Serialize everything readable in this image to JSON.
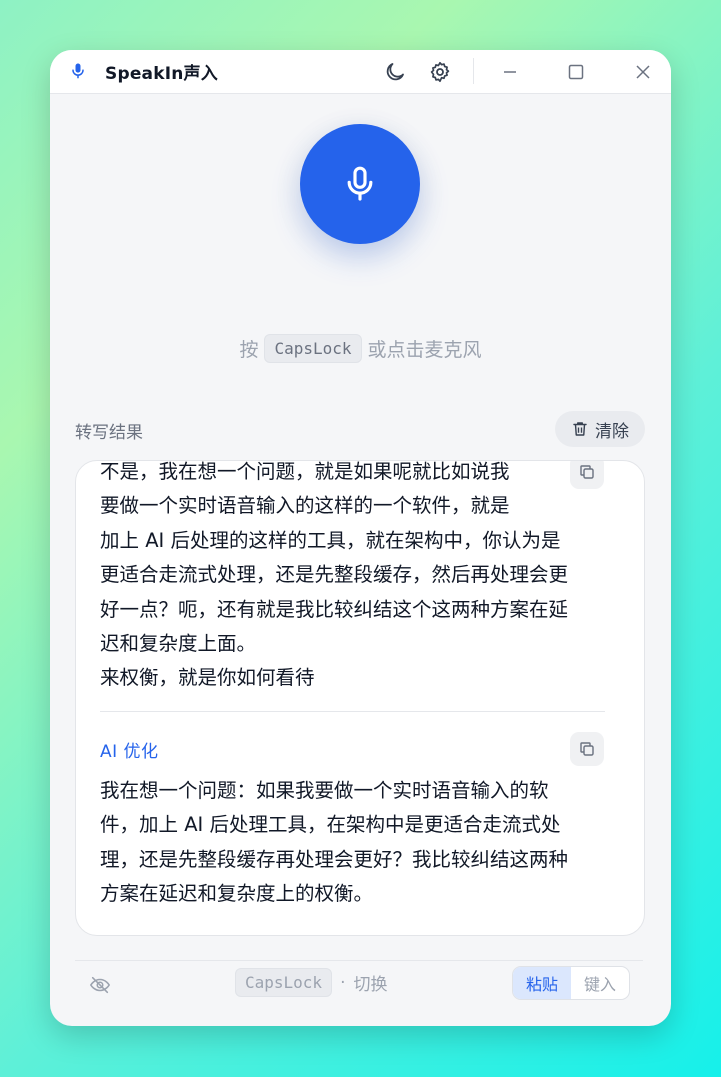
{
  "app": {
    "title": "SpeakIn声入"
  },
  "colors": {
    "accent": "#2563eb",
    "background": "#f5f6f8"
  },
  "icons": {
    "app": "mic-icon",
    "theme": "moon-icon",
    "settings": "gear-icon",
    "minimize": "minimize-icon",
    "maximize": "maximize-icon",
    "close": "close-icon",
    "record": "mic-icon",
    "clear": "trash-icon",
    "copy": "copy-icon",
    "privacy": "eye-off-icon"
  },
  "hint": {
    "prefix": "按",
    "key": "CapsLock",
    "suffix": "或点击麦克风"
  },
  "transcript": {
    "section_label": "转写结果",
    "clear_label": "清除",
    "raw_text": "不是，我在想一个问题，就是如果呢就比如说我\n要做一个实时语音输入的这样的一个软件，就是\n加上 AI 后处理的这样的工具，就在架构中，你认为是\n更适合走流式处理，还是先整段缓存，然后再处理会更\n好一点？呃，还有就是我比较纠结这个这两种方案在延\n迟和复杂度上面。\n来权衡，就是你如何看待",
    "ai_label": "AI 优化",
    "ai_text": "我在想一个问题：如果我要做一个实时语音输入的软\n件，加上 AI 后处理工具，在架构中是更适合走流式处\n理，还是先整段缓存再处理会更好？我比较纠结这两种\n方案在延迟和复杂度上的权衡。"
  },
  "footer": {
    "key": "CapsLock",
    "separator": "·",
    "toggle_label": "切换",
    "modes": [
      {
        "label": "粘贴",
        "active": true
      },
      {
        "label": "键入",
        "active": false
      }
    ]
  }
}
